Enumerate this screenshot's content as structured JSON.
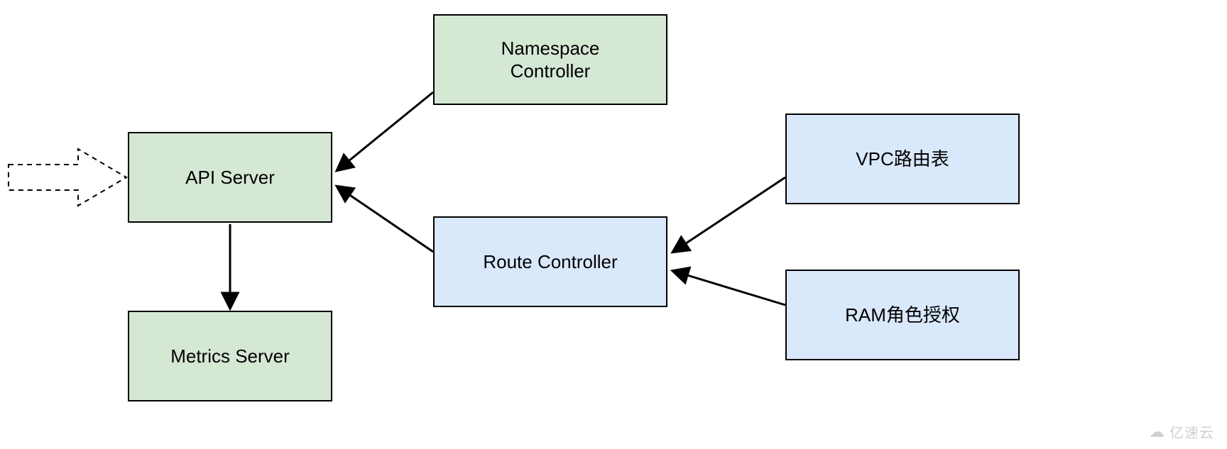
{
  "diagram": {
    "nodes": {
      "api_server": {
        "label": "API Server",
        "color": "green"
      },
      "metrics_server": {
        "label": "Metrics Server",
        "color": "green"
      },
      "namespace_controller": {
        "label": "Namespace\nController",
        "color": "green"
      },
      "route_controller": {
        "label": "Route Controller",
        "color": "blue"
      },
      "vpc_route_table": {
        "label": "VPC路由表",
        "color": "blue"
      },
      "ram_role_auth": {
        "label": "RAM角色授权",
        "color": "blue"
      }
    },
    "edges": [
      {
        "from": "external",
        "to": "api_server",
        "style": "dashed"
      },
      {
        "from": "api_server",
        "to": "metrics_server",
        "style": "solid"
      },
      {
        "from": "namespace_controller",
        "to": "api_server",
        "style": "solid"
      },
      {
        "from": "route_controller",
        "to": "api_server",
        "style": "solid"
      },
      {
        "from": "vpc_route_table",
        "to": "route_controller",
        "style": "solid"
      },
      {
        "from": "ram_role_auth",
        "to": "route_controller",
        "style": "solid"
      }
    ]
  },
  "watermark": {
    "text": "亿速云"
  }
}
